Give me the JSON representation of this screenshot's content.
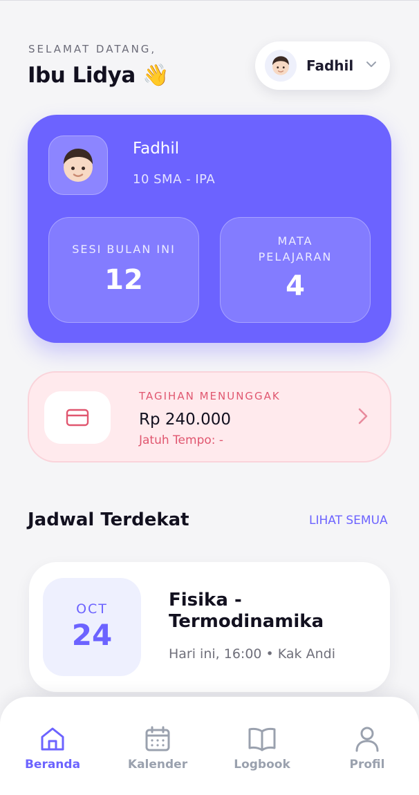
{
  "header": {
    "greeting": "SELAMAT DATANG,",
    "parent_name": "Ibu Lidya 👋",
    "child_selector": {
      "name": "Fadhil",
      "avatar_icon": "boy-avatar-icon",
      "chevron_icon": "chevron-down-icon"
    }
  },
  "student_card": {
    "name": "Fadhil",
    "class": "10 SMA - IPA",
    "avatar_icon": "boy-avatar-icon",
    "stats": [
      {
        "label": "SESI BULAN INI",
        "value": "12"
      },
      {
        "label": "MATA PELAJARAN",
        "value": "4"
      }
    ],
    "bg_color": "#6c63ff"
  },
  "bill": {
    "label": "TAGIHAN MENUNGGAK",
    "amount": "Rp 240.000",
    "due": "Jatuh Tempo: -",
    "icon": "credit-card-icon",
    "accent_color": "#e0566f"
  },
  "schedule": {
    "title": "Jadwal Terdekat",
    "see_all": "LIHAT SEMUA",
    "items": [
      {
        "month": "OCT",
        "day": "24",
        "subject": "Fisika - Termodinamika",
        "meta": "Hari ini, 16:00 • Kak Andi"
      }
    ]
  },
  "bottom_nav": {
    "items": [
      {
        "label": "Beranda",
        "icon": "home-icon",
        "active": true
      },
      {
        "label": "Kalender",
        "icon": "calendar-icon",
        "active": false
      },
      {
        "label": "Logbook",
        "icon": "book-icon",
        "active": false
      },
      {
        "label": "Profil",
        "icon": "user-icon",
        "active": false
      }
    ],
    "active_color": "#6c63ff",
    "inactive_color": "#9aa1ae"
  }
}
